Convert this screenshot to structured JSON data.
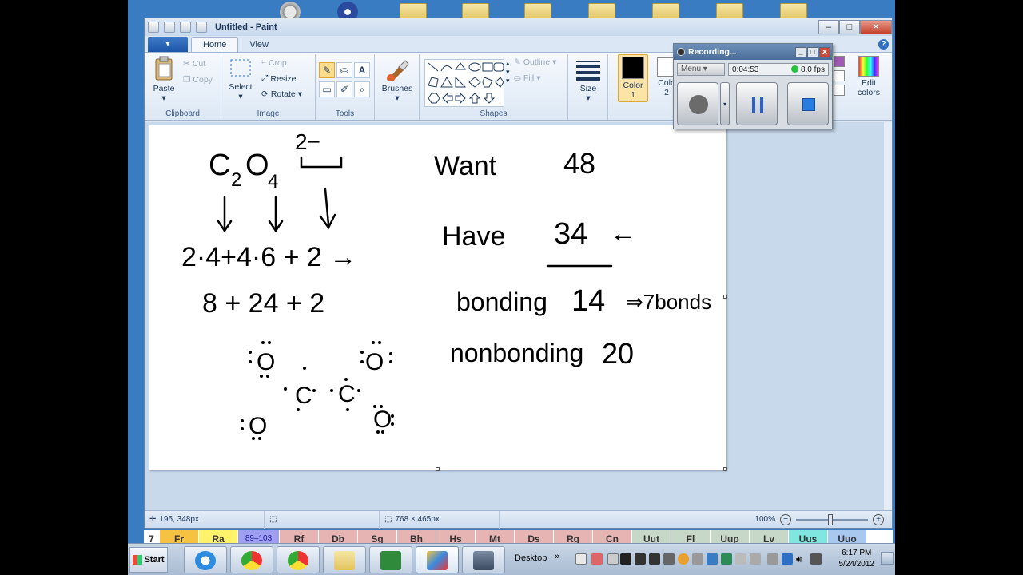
{
  "window": {
    "title": "Untitled - Paint",
    "controls": {
      "minimize": "–",
      "maximize": "□",
      "close": "✕"
    },
    "help": "?"
  },
  "tabs": {
    "app_menu": "▾",
    "home": "Home",
    "view": "View"
  },
  "ribbon": {
    "clipboard": {
      "label": "Clipboard",
      "paste": "Paste",
      "cut": "Cut",
      "copy": "Copy"
    },
    "image": {
      "label": "Image",
      "select": "Select",
      "crop": "Crop",
      "resize": "Resize",
      "rotate": "Rotate"
    },
    "tools": {
      "label": "Tools"
    },
    "brushes": {
      "label": "Brushes"
    },
    "shapes": {
      "label": "Shapes",
      "outline": "Outline",
      "fill": "Fill"
    },
    "size": {
      "label": "Size"
    },
    "color1": {
      "label": "Color",
      "num": "1"
    },
    "color2": {
      "label": "Colo",
      "num": "2"
    },
    "edit_colors": {
      "label1": "Edit",
      "label2": "colors"
    }
  },
  "canvas": {
    "drawing": {
      "formula_c": "C",
      "formula_sub2": "2",
      "formula_o": "O",
      "formula_sub4": "4",
      "charge": "2−",
      "line1": "2·4+4·6 + 2 →",
      "line2": "8 + 24 + 2",
      "want_label": "Want",
      "want_value": "48",
      "have_label": "Have",
      "have_value": "34",
      "have_arrow": "←",
      "bonding_label": "bonding",
      "bonding_value": "14",
      "bonding_result": "⇒7bonds",
      "nonbonding_label": "nonbonding",
      "nonbonding_value": "20"
    }
  },
  "statusbar": {
    "cursor": "195, 348px",
    "selection": "",
    "size": "768 × 465px",
    "zoom": "100%"
  },
  "recorder": {
    "title": "Recording...",
    "menu": "Menu",
    "time": "0:04:53",
    "fps": "8.0 fps"
  },
  "periodic": {
    "row_number": "7",
    "cells": [
      {
        "sym": "Fr",
        "color": "#f5c242"
      },
      {
        "sym": "Ra",
        "color": "#fff36b"
      },
      {
        "sym": "89–103",
        "color": "#9f9ff2"
      },
      {
        "sym": "Rf",
        "color": "#e7b4b4"
      },
      {
        "sym": "Db",
        "color": "#e7b4b4"
      },
      {
        "sym": "Sg",
        "color": "#e7b4b4"
      },
      {
        "sym": "Bh",
        "color": "#e7b4b4"
      },
      {
        "sym": "Hs",
        "color": "#e7b4b4"
      },
      {
        "sym": "Mt",
        "color": "#e7b4b4"
      },
      {
        "sym": "Ds",
        "color": "#e7b4b4"
      },
      {
        "sym": "Rg",
        "color": "#e7b4b4"
      },
      {
        "sym": "Cn",
        "color": "#e7b4b4"
      },
      {
        "sym": "Uut",
        "color": "#c8d8c8"
      },
      {
        "sym": "Fl",
        "color": "#c8d8c8"
      },
      {
        "sym": "Uup",
        "color": "#c8d8c8"
      },
      {
        "sym": "Lv",
        "color": "#c8d8c8"
      },
      {
        "sym": "Uus",
        "color": "#7fe6e0"
      },
      {
        "sym": "Uuo",
        "color": "#a8c8f0"
      }
    ]
  },
  "taskbar": {
    "start": "Start",
    "desktop": "Desktop",
    "time": "6:17 PM",
    "date": "5/24/2012"
  }
}
